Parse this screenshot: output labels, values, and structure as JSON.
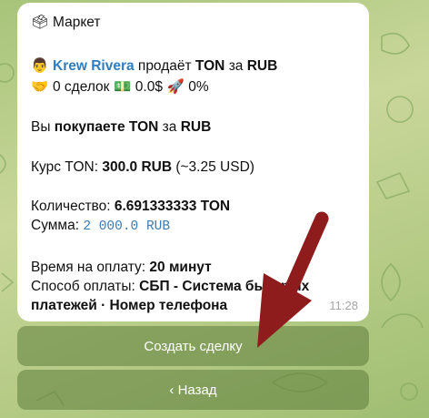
{
  "message": {
    "header": {
      "icon": "ballot-box-icon",
      "title": "Маркет"
    },
    "seller_line": {
      "icon": "person-icon",
      "seller_name": "Krew Rivera",
      "verb": "продаёт",
      "asset": "TON",
      "conjunction": "за",
      "currency": "RUB"
    },
    "stats_line": {
      "deals_icon": "handshake-icon",
      "deals_text": "0 сделок",
      "money_icon": "money-icon",
      "amount_text": "0.0$",
      "rocket_icon": "rocket-icon",
      "percent_text": "0%"
    },
    "buy_line": {
      "prefix": "Вы",
      "verb": "покупаете TON",
      "conjunction": "за",
      "currency": "RUB"
    },
    "rate": {
      "label": "Курс TON:",
      "value": "300.0 RUB",
      "extra": "(~3.25 USD)"
    },
    "quantity": {
      "label": "Количество:",
      "value": "6.691333333 TON"
    },
    "sum": {
      "label": "Сумма:",
      "value": "2 000.0 RUB"
    },
    "payment_time": {
      "label": "Время на оплату:",
      "value": "20 минут"
    },
    "payment_method": {
      "label": "Способ оплаты:",
      "value_line1": "СБП - Система быстрых",
      "value_line2": "платежей · Номер телефона"
    },
    "time": "11:28"
  },
  "buttons": {
    "create_deal": "Создать сделку",
    "back": "‹ Назад"
  },
  "colors": {
    "accent_link": "#2f7dbf",
    "annotation_arrow": "#8f1c1c",
    "button_bg": "#6f8f4a"
  }
}
